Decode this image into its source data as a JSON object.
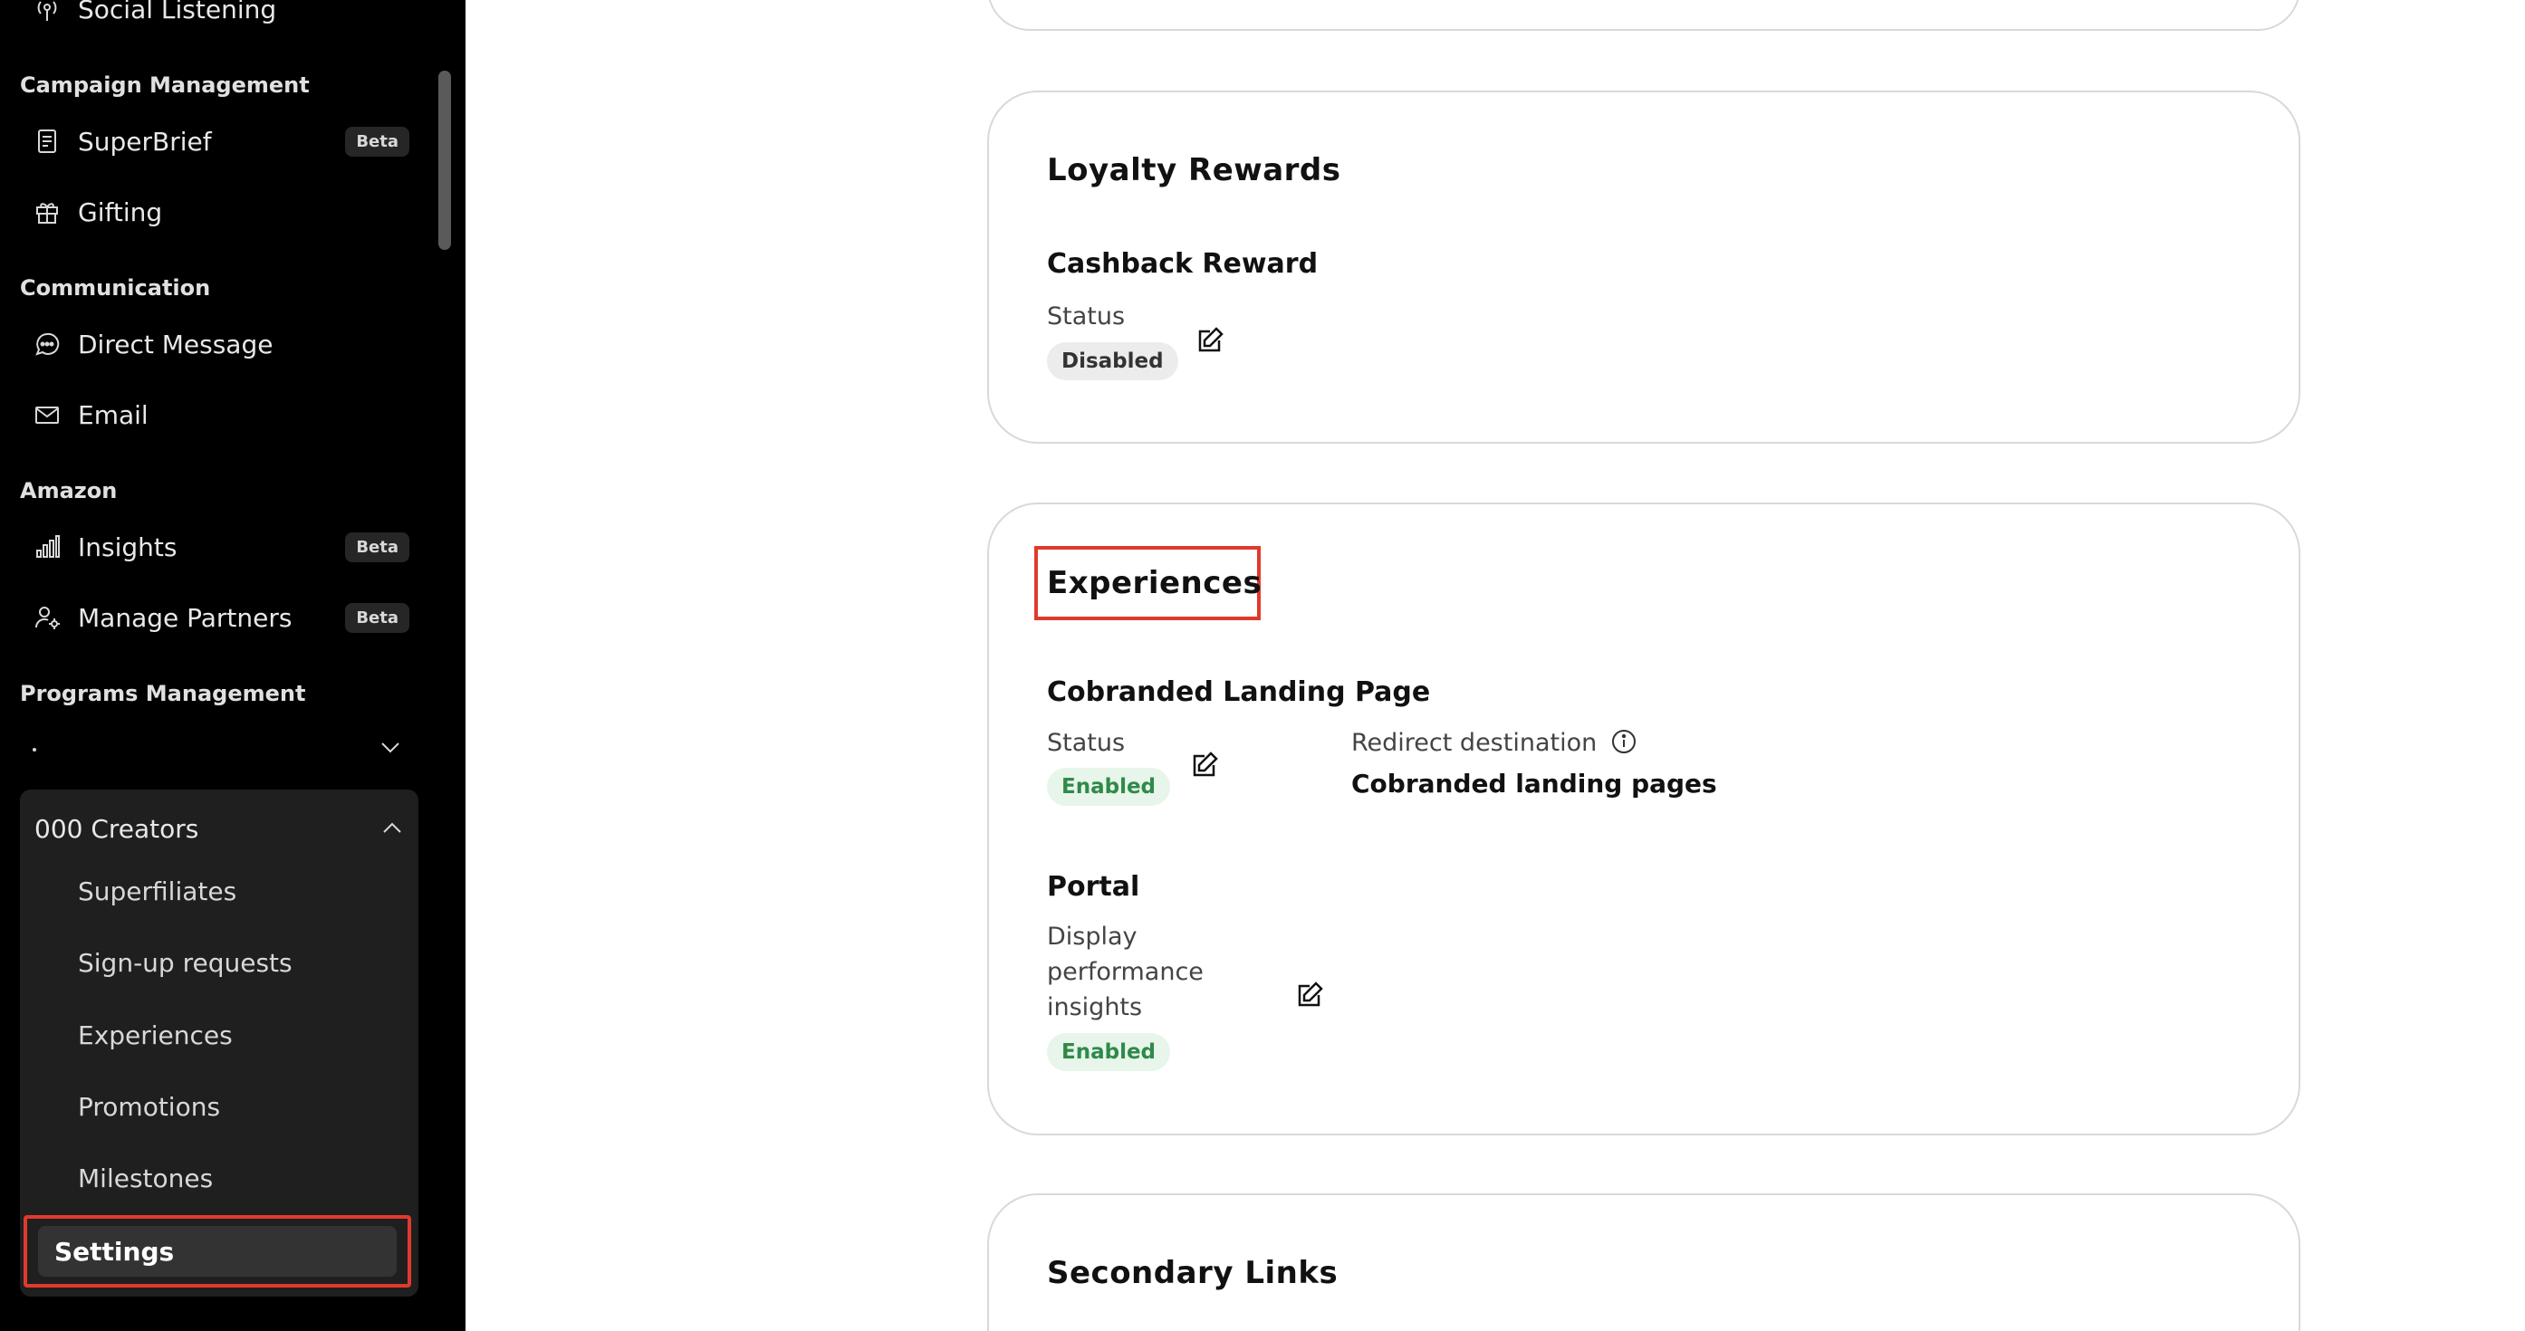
{
  "sidebar": {
    "top_item": "Social Listening",
    "sections": {
      "campaign": "Campaign Management",
      "communication": "Communication",
      "amazon": "Amazon",
      "programs": "Programs Management"
    },
    "items": {
      "superbrief": "SuperBrief",
      "gifting": "Gifting",
      "direct_message": "Direct Message",
      "email": "Email",
      "insights": "Insights",
      "manage_partners": "Manage Partners"
    },
    "beta_label": "Beta",
    "program_dot": ".",
    "group": {
      "title": "000 Creators",
      "items": [
        "Superfiliates",
        "Sign-up requests",
        "Experiences",
        "Promotions",
        "Milestones"
      ],
      "active": "Settings"
    }
  },
  "main": {
    "loyalty": {
      "title": "Loyalty Rewards",
      "subtitle": "Cashback Reward",
      "status_label": "Status",
      "status_value": "Disabled"
    },
    "experiences": {
      "title": "Experiences",
      "landing": {
        "subtitle": "Cobranded Landing Page",
        "status_label": "Status",
        "status_value": "Enabled",
        "redirect_label": "Redirect destination",
        "redirect_value": "Cobranded landing pages"
      },
      "portal": {
        "subtitle": "Portal",
        "label_line1": "Display",
        "label_line2": "performance",
        "label_line3": "insights",
        "status_value": "Enabled"
      }
    },
    "secondary": {
      "title": "Secondary Links"
    }
  }
}
